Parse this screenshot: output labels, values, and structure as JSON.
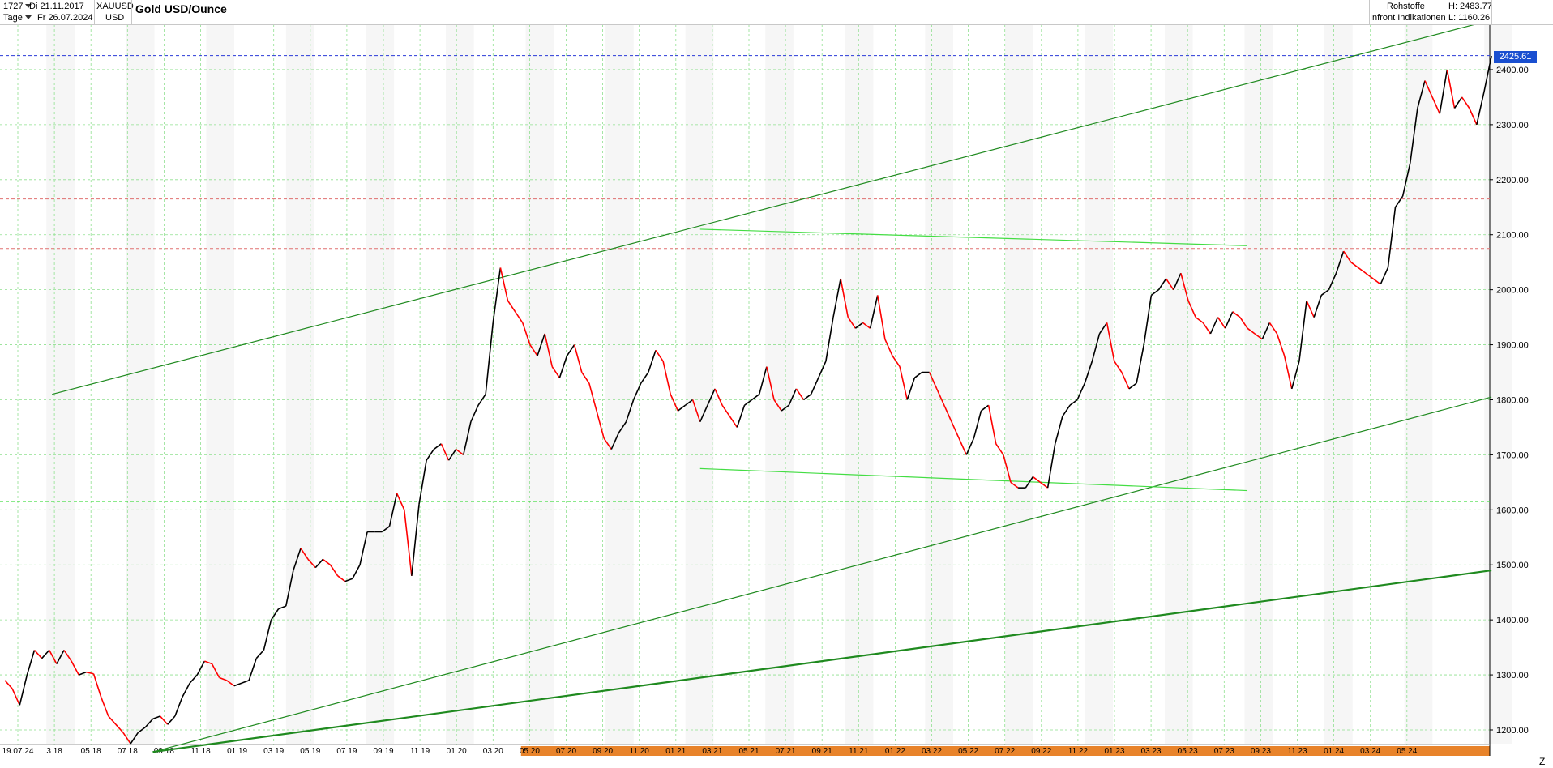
{
  "header": {
    "count": "1727",
    "from_date": "Di 21.11.2017",
    "timeframe": "Tage",
    "to_date": "Fr 26.07.2024",
    "symbol": "XAUUSD",
    "currency": "USD",
    "title": "Gold USD/Ounce",
    "category": "Rohstoffe",
    "source": "Infront Indikationen",
    "high": "H: 2483.77",
    "low": "L: 1160.26"
  },
  "price_badge": "2425.61",
  "corner_label": "Z",
  "colors": {
    "up": "#000000",
    "down": "#ff0000",
    "trend": "#22a022",
    "support": "#44dd44",
    "grid": "#8fe08f",
    "level": "#e07070",
    "badge": "#1a4fd0",
    "band": "#e8832a"
  },
  "chart_data": {
    "type": "line",
    "title": "Gold USD/Ounce",
    "xlabel": "",
    "ylabel": "",
    "ylim": [
      1160,
      2500
    ],
    "y_ticks": [
      1200,
      1300,
      1400,
      1500,
      1600,
      1700,
      1800,
      1900,
      2000,
      2100,
      2200,
      2300,
      2400
    ],
    "x_ticks": [
      "19.07.24",
      "3 18",
      "05 18",
      "07 18",
      "09 18",
      "11 18",
      "01 19",
      "03 19",
      "05 19",
      "07 19",
      "09 19",
      "11 19",
      "01 20",
      "03 20",
      "05 20",
      "07 20",
      "09 20",
      "11 20",
      "01 21",
      "03 21",
      "05 21",
      "07 21",
      "09 21",
      "11 21",
      "01 22",
      "03 22",
      "05 22",
      "07 22",
      "09 22",
      "11 22",
      "01 23",
      "03 23",
      "05 23",
      "07 23",
      "09 23",
      "11 23",
      "01 24",
      "03 24",
      "05 24"
    ],
    "highlighted_x_ticks_from": "05 20",
    "grid": true,
    "high": 2483.77,
    "low": 1160.26,
    "last": 2425.61,
    "series": [
      {
        "values": [
          [
            0,
            1290
          ],
          [
            0.5,
            1275
          ],
          [
            1,
            1245
          ],
          [
            1.5,
            1300
          ],
          [
            2,
            1345
          ],
          [
            2.5,
            1330
          ],
          [
            3,
            1345
          ],
          [
            3.5,
            1320
          ],
          [
            4,
            1345
          ],
          [
            4.5,
            1325
          ],
          [
            5,
            1300
          ],
          [
            5.5,
            1305
          ],
          [
            6,
            1302
          ],
          [
            6.5,
            1260
          ],
          [
            7,
            1225
          ],
          [
            7.5,
            1210
          ],
          [
            8,
            1195
          ],
          [
            8.5,
            1175
          ],
          [
            9,
            1195
          ],
          [
            9.5,
            1205
          ],
          [
            10,
            1220
          ],
          [
            10.5,
            1225
          ],
          [
            11,
            1210
          ],
          [
            11.5,
            1225
          ],
          [
            12,
            1260
          ],
          [
            12.5,
            1285
          ],
          [
            13,
            1300
          ],
          [
            13.5,
            1325
          ],
          [
            14,
            1320
          ],
          [
            14.5,
            1295
          ],
          [
            15,
            1290
          ],
          [
            15.5,
            1280
          ],
          [
            16,
            1285
          ],
          [
            16.5,
            1290
          ],
          [
            17,
            1330
          ],
          [
            17.5,
            1345
          ],
          [
            18,
            1400
          ],
          [
            18.5,
            1420
          ],
          [
            19,
            1425
          ],
          [
            19.5,
            1490
          ],
          [
            20,
            1530
          ],
          [
            20.5,
            1510
          ],
          [
            21,
            1495
          ],
          [
            21.5,
            1510
          ],
          [
            22,
            1500
          ],
          [
            22.5,
            1480
          ],
          [
            23,
            1470
          ],
          [
            23.5,
            1475
          ],
          [
            24,
            1500
          ],
          [
            24.5,
            1560
          ],
          [
            25,
            1560
          ],
          [
            25.5,
            1560
          ],
          [
            26,
            1570
          ],
          [
            26.5,
            1630
          ],
          [
            27,
            1600
          ],
          [
            27.5,
            1480
          ],
          [
            28,
            1610
          ],
          [
            28.5,
            1690
          ],
          [
            29,
            1710
          ],
          [
            29.5,
            1720
          ],
          [
            30,
            1690
          ],
          [
            30.5,
            1710
          ],
          [
            31,
            1700
          ],
          [
            31.5,
            1760
          ],
          [
            32,
            1790
          ],
          [
            32.5,
            1810
          ],
          [
            33,
            1940
          ],
          [
            33.5,
            2040
          ],
          [
            34,
            1980
          ],
          [
            34.5,
            1960
          ],
          [
            35,
            1940
          ],
          [
            35.5,
            1900
          ],
          [
            36,
            1880
          ],
          [
            36.5,
            1920
          ],
          [
            37,
            1860
          ],
          [
            37.5,
            1840
          ],
          [
            38,
            1880
          ],
          [
            38.5,
            1900
          ],
          [
            39,
            1850
          ],
          [
            39.5,
            1830
          ],
          [
            40,
            1780
          ],
          [
            40.5,
            1730
          ],
          [
            41,
            1710
          ],
          [
            41.5,
            1740
          ],
          [
            42,
            1760
          ],
          [
            42.5,
            1800
          ],
          [
            43,
            1830
          ],
          [
            43.5,
            1850
          ],
          [
            44,
            1890
          ],
          [
            44.5,
            1870
          ],
          [
            45,
            1810
          ],
          [
            45.5,
            1780
          ],
          [
            46,
            1790
          ],
          [
            46.5,
            1800
          ],
          [
            47,
            1760
          ],
          [
            47.5,
            1790
          ],
          [
            48,
            1820
          ],
          [
            48.5,
            1790
          ],
          [
            49,
            1770
          ],
          [
            49.5,
            1750
          ],
          [
            50,
            1790
          ],
          [
            50.5,
            1800
          ],
          [
            51,
            1810
          ],
          [
            51.5,
            1860
          ],
          [
            52,
            1800
          ],
          [
            52.5,
            1780
          ],
          [
            53,
            1790
          ],
          [
            53.5,
            1820
          ],
          [
            54,
            1800
          ],
          [
            54.5,
            1810
          ],
          [
            55,
            1840
          ],
          [
            55.5,
            1870
          ],
          [
            56,
            1950
          ],
          [
            56.5,
            2020
          ],
          [
            57,
            1950
          ],
          [
            57.5,
            1930
          ],
          [
            58,
            1940
          ],
          [
            58.5,
            1930
          ],
          [
            59,
            1990
          ],
          [
            59.5,
            1910
          ],
          [
            60,
            1880
          ],
          [
            60.5,
            1860
          ],
          [
            61,
            1800
          ],
          [
            61.5,
            1840
          ],
          [
            62,
            1850
          ],
          [
            62.5,
            1850
          ],
          [
            63,
            1820
          ],
          [
            63.5,
            1790
          ],
          [
            64,
            1760
          ],
          [
            64.5,
            1730
          ],
          [
            65,
            1700
          ],
          [
            65.5,
            1730
          ],
          [
            66,
            1780
          ],
          [
            66.5,
            1790
          ],
          [
            67,
            1720
          ],
          [
            67.5,
            1700
          ],
          [
            68,
            1650
          ],
          [
            68.5,
            1640
          ],
          [
            69,
            1640
          ],
          [
            69.5,
            1660
          ],
          [
            70,
            1650
          ],
          [
            70.5,
            1640
          ],
          [
            71,
            1720
          ],
          [
            71.5,
            1770
          ],
          [
            72,
            1790
          ],
          [
            72.5,
            1800
          ],
          [
            73,
            1830
          ],
          [
            73.5,
            1870
          ],
          [
            74,
            1920
          ],
          [
            74.5,
            1940
          ],
          [
            75,
            1870
          ],
          [
            75.5,
            1850
          ],
          [
            76,
            1820
          ],
          [
            76.5,
            1830
          ],
          [
            77,
            1900
          ],
          [
            77.5,
            1990
          ],
          [
            78,
            2000
          ],
          [
            78.5,
            2020
          ],
          [
            79,
            2000
          ],
          [
            79.5,
            2030
          ],
          [
            80,
            1980
          ],
          [
            80.5,
            1950
          ],
          [
            81,
            1940
          ],
          [
            81.5,
            1920
          ],
          [
            82,
            1950
          ],
          [
            82.5,
            1930
          ],
          [
            83,
            1960
          ],
          [
            83.5,
            1950
          ],
          [
            84,
            1930
          ],
          [
            84.5,
            1920
          ],
          [
            85,
            1910
          ],
          [
            85.5,
            1940
          ],
          [
            86,
            1920
          ],
          [
            86.5,
            1880
          ],
          [
            87,
            1820
          ],
          [
            87.5,
            1870
          ],
          [
            88,
            1980
          ],
          [
            88.5,
            1950
          ],
          [
            89,
            1990
          ],
          [
            89.5,
            2000
          ],
          [
            90,
            2030
          ],
          [
            90.5,
            2070
          ],
          [
            91,
            2050
          ],
          [
            91.5,
            2040
          ],
          [
            92,
            2030
          ],
          [
            92.5,
            2020
          ],
          [
            93,
            2010
          ],
          [
            93.5,
            2040
          ],
          [
            94,
            2150
          ],
          [
            94.5,
            2170
          ],
          [
            95,
            2230
          ],
          [
            95.5,
            2330
          ],
          [
            96,
            2380
          ],
          [
            96.5,
            2350
          ],
          [
            97,
            2320
          ],
          [
            97.5,
            2400
          ],
          [
            98,
            2330
          ],
          [
            98.5,
            2350
          ],
          [
            99,
            2330
          ],
          [
            99.5,
            2300
          ],
          [
            100,
            2360
          ],
          [
            100.5,
            2425
          ]
        ]
      }
    ],
    "trendlines": [
      {
        "style": "thin",
        "from": [
          1,
          1810
        ],
        "to": [
          100.5,
          2490
        ]
      },
      {
        "style": "thin",
        "from": [
          10,
          1160
        ],
        "to": [
          100.5,
          1805
        ]
      },
      {
        "style": "thick",
        "from": [
          10,
          1160
        ],
        "to": [
          100.5,
          1490
        ]
      },
      {
        "style": "support",
        "from": [
          47,
          2110
        ],
        "to": [
          84,
          2080
        ]
      },
      {
        "style": "support",
        "from": [
          47,
          1675
        ],
        "to": [
          84,
          1635
        ]
      }
    ],
    "levels": [
      {
        "value": 2425.61,
        "style": "dashed-blue"
      },
      {
        "value": 2165,
        "style": "dashed-red"
      },
      {
        "value": 2075,
        "style": "dashed-red"
      },
      {
        "value": 1615,
        "style": "dashed-green"
      }
    ]
  }
}
